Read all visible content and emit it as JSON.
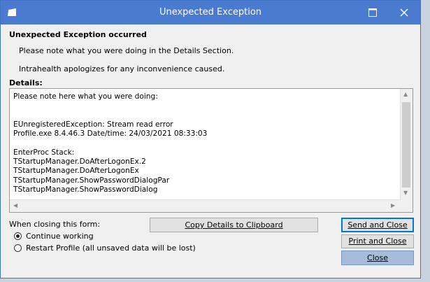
{
  "window": {
    "title": "Unexpected Exception",
    "maximize_icon": "maximize-icon",
    "close_icon": "close-icon"
  },
  "header": {
    "heading": "Unexpected Exception occurred",
    "line1": "Please note what you were doing in the Details Section.",
    "line2": "Intrahealth apologizes for any inconvenience caused."
  },
  "details": {
    "label": "Details:",
    "text": "Please note here what you were doing:\n\n\nEUnregisteredException: Stream read error\nProfile.exe 8.4.46.3 Date/time: 24/03/2021 08:33:03\n\nEnterProc Stack:\nTStartupManager.DoAfterLogonEx.2\nTStartupManager.DoAfterLogonEx\nTStartupManager.ShowPasswordDialogPar\nTStartupManager.ShowPasswordDialog"
  },
  "closing": {
    "label": "When closing this form:",
    "options": [
      {
        "label": "Continue working",
        "selected": true
      },
      {
        "label": "Restart Profile (all unsaved data will be lost)",
        "selected": false
      }
    ]
  },
  "buttons": {
    "copy": "Copy Details to Clipboard",
    "send": "Send and Close",
    "print": "Print and Close",
    "close": "Close"
  },
  "colors": {
    "titlebar": "#4a7bd0",
    "default_button_border": "#0078d7",
    "close_button": "#a6bcd9"
  }
}
